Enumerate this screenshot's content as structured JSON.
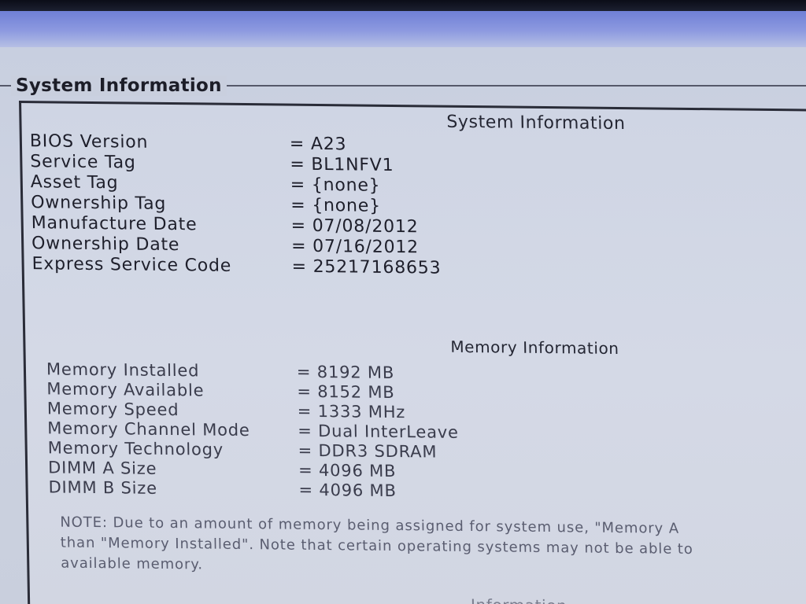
{
  "group": {
    "title": "System Information"
  },
  "system": {
    "heading": "System Information",
    "rows": [
      {
        "label": "BIOS Version",
        "value": "= A23"
      },
      {
        "label": "Service Tag",
        "value": "= BL1NFV1"
      },
      {
        "label": "Asset Tag",
        "value": "= {none}"
      },
      {
        "label": "Ownership Tag",
        "value": "= {none}"
      },
      {
        "label": "Manufacture Date",
        "value": "= 07/08/2012"
      },
      {
        "label": "Ownership Date",
        "value": "= 07/16/2012"
      },
      {
        "label": "Express Service Code",
        "value": "= 25217168653"
      }
    ]
  },
  "memory": {
    "heading": "Memory Information",
    "rows": [
      {
        "label": "Memory Installed",
        "value": "= 8192 MB"
      },
      {
        "label": "Memory Available",
        "value": "= 8152 MB"
      },
      {
        "label": "Memory Speed",
        "value": "= 1333 MHz"
      },
      {
        "label": "Memory Channel Mode",
        "value": "= Dual InterLeave"
      },
      {
        "label": "Memory Technology",
        "value": "= DDR3 SDRAM"
      },
      {
        "label": "DIMM A Size",
        "value": "= 4096 MB"
      },
      {
        "label": "DIMM B Size",
        "value": "= 4096 MB"
      }
    ],
    "note_lines": [
      "NOTE: Due to an amount of memory being assigned for system use, \"Memory A",
      "than \"Memory Installed\". Note that certain operating systems may not be able to",
      "available memory."
    ]
  },
  "next_section": {
    "heading": "Information"
  }
}
